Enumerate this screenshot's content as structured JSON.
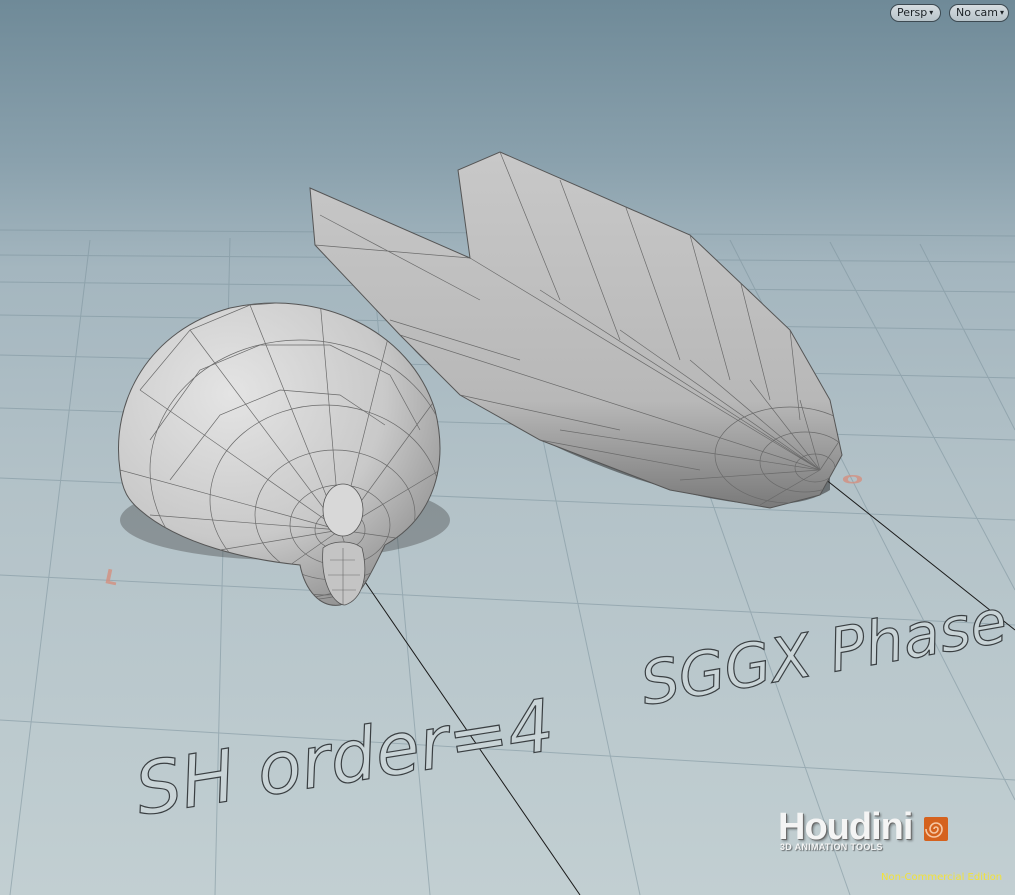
{
  "viewport": {
    "camera_menu_label": "Persp",
    "camera_select_label": "No cam",
    "caret": "▾"
  },
  "scene": {
    "label_sh": "SH order=4",
    "label_sggx": "SGGX Phase",
    "axis_marker_left": "L",
    "axis_marker_right": "O"
  },
  "branding": {
    "logo_text": "Houdini",
    "logo_subtitle": "3D ANIMATION TOOLS",
    "edition_text": "Non-Commercial Edition"
  },
  "colors": {
    "sky_top": "#6f8a98",
    "ground": "#c2cfd2",
    "mesh_fill": "#cfcfcf",
    "mesh_wire": "#6a6a6a",
    "edition_text": "#f2e23a",
    "axis_marker": "#d49080"
  }
}
